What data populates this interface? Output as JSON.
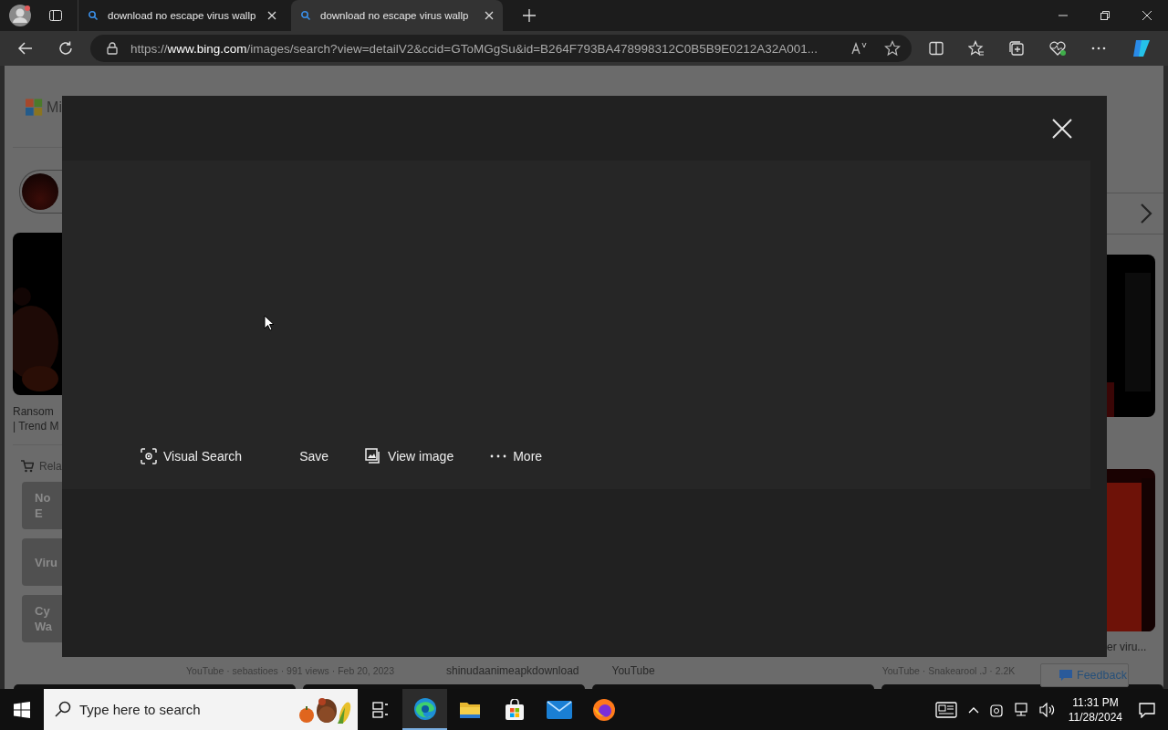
{
  "tabs": [
    {
      "title": "download no escape virus wallp",
      "selected": false
    },
    {
      "title": "download no escape virus wallp",
      "selected": true
    }
  ],
  "address": "https://**www.bing.com**/images/search?view=detailV2&ccid=GToMGgSu&id=B264F793BA478998312C0B5B9E0212A32A001...",
  "page": {
    "logo_text": "Mi",
    "left_caption": [
      "Ransom",
      "| Trend M"
    ],
    "related_label": "Rela",
    "related_items": [
      [
        "No",
        "E"
      ],
      [
        "Viru"
      ],
      [
        "Cy",
        "Wa"
      ]
    ],
    "right_caption": "er viru...",
    "bottom_captions": [
      "YouTube · sebastioes · 991 views · Feb 20, 2023",
      "shinudaanimeapkdownload",
      "YouTube",
      "YouTube · Snakearool .J · 2.2K"
    ],
    "feedback": "Feedback"
  },
  "modal": {
    "actions": [
      {
        "kind": "visual-search",
        "label": "Visual Search"
      },
      {
        "kind": "save",
        "label": "Save"
      },
      {
        "kind": "view-image",
        "label": "View image"
      },
      {
        "kind": "more",
        "label": "More"
      }
    ]
  },
  "taskbar": {
    "search_placeholder": "Type here to search",
    "apps": [
      {
        "kind": "task-view",
        "selected": false
      },
      {
        "kind": "edge",
        "selected": true
      },
      {
        "kind": "files",
        "selected": false
      },
      {
        "kind": "store",
        "selected": false
      },
      {
        "kind": "mail",
        "selected": false
      },
      {
        "kind": "firefox",
        "selected": false
      }
    ],
    "time": "11:31 PM",
    "date": "11/28/2024"
  }
}
